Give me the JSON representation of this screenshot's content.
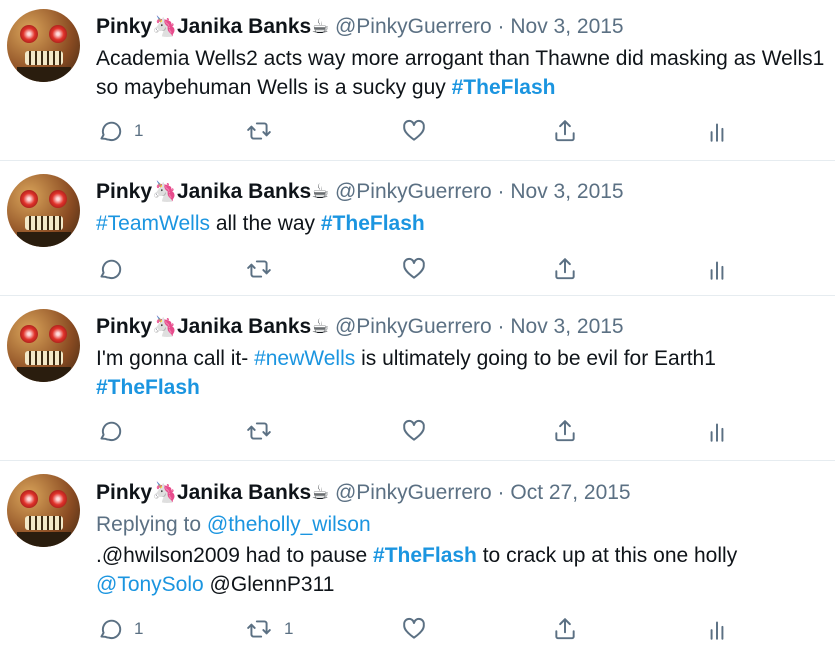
{
  "tweets": [
    {
      "name": "Pinky",
      "unicorn": "🦄",
      "name2": "Janika Banks",
      "coffee": "☕",
      "handle": "@PinkyGuerrero",
      "sep": "·",
      "date": "Nov 3, 2015",
      "text1": "Academia Wells2 acts way more arrogant than Thawne did masking as Wells1 so maybehuman Wells is a sucky guy ",
      "tag1": "#TheFlash",
      "reply_count": "1",
      "retweet_count": ""
    },
    {
      "name": "Pinky",
      "unicorn": "🦄",
      "name2": "Janika Banks",
      "coffee": "☕",
      "handle": "@PinkyGuerrero",
      "sep": "·",
      "date": "Nov 3, 2015",
      "tag0": "#TeamWells",
      "text1": " all the way ",
      "tag1": "#TheFlash",
      "reply_count": "",
      "retweet_count": ""
    },
    {
      "name": "Pinky",
      "unicorn": "🦄",
      "name2": "Janika Banks",
      "coffee": "☕",
      "handle": "@PinkyGuerrero",
      "sep": "·",
      "date": "Nov 3, 2015",
      "text0": "I'm gonna call it- ",
      "tag0": "#newWells",
      "text1": " is ultimately going to be evil for Earth1",
      "tag1": "#TheFlash",
      "reply_count": "",
      "retweet_count": ""
    },
    {
      "name": "Pinky",
      "unicorn": "🦄",
      "name2": "Janika Banks",
      "coffee": "☕",
      "handle": "@PinkyGuerrero",
      "sep": "·",
      "date": "Oct 27, 2015",
      "replying_label": "Replying to ",
      "replying_to": "@theholly_wilson",
      "text0": ".@hwilson2009 had to pause ",
      "tag0": "#TheFlash",
      "text1": " to crack up at this one holly",
      "mention1": "@TonySolo",
      "text2": " @GlennP311",
      "reply_count": "1",
      "retweet_count": "1"
    }
  ],
  "icons": {
    "reply": "reply-icon",
    "retweet": "retweet-icon",
    "like": "heart-icon",
    "share": "share-icon",
    "analytics": "analytics-icon"
  },
  "colors": {
    "link": "#1b95e0",
    "muted": "#5b7083",
    "text": "#0f1419",
    "divider": "#e6ecf0"
  }
}
